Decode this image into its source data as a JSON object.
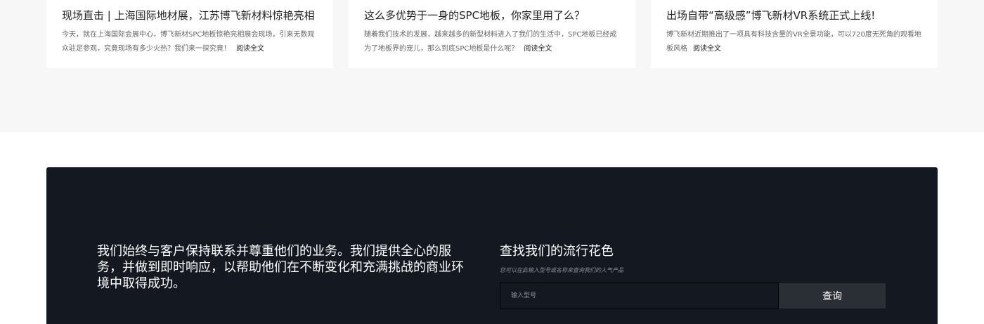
{
  "news": {
    "cards": [
      {
        "title": "现场直击 | 上海国际地材展，江苏博飞新材料惊艳亮相",
        "text": "今天，就在上海国际会展中心，博飞新材SPC地板惊艳亮相展会现场，引来无数观众驻足参观，究竟现场有多少火热？我们来一探究竟！",
        "read_more": "阅读全文"
      },
      {
        "title": "这么多优势于一身的SPC地板，你家里用了么？",
        "text": "随着我们技术的发展，越来越多的新型材料进入了我们的生活中，SPC地板已经成为了地板界的宠儿，那么到底SPC地板是什么呢？",
        "read_more": "阅读全文"
      },
      {
        "title": "出场自带“高级感”博飞新材VR系统正式上线!",
        "text": "博飞新材近期推出了一项具有科技含量的VR全景功能，可以720度无死角的观看地板风格",
        "read_more": "阅读全文"
      }
    ]
  },
  "cta": {
    "text": "我们始终与客户保持联系并尊重他们的业务。我们提供全心的服务，并做到即时响应，以帮助他们在不断变化和充满挑战的商业环境中取得成功。",
    "title": "查找我们的流行花色",
    "subtitle": "您可以在此输入型号或名称来查询我们的人气产品",
    "search_placeholder": "输入型号",
    "search_button": "查询"
  },
  "colors": {
    "band_bg": "#f7f7f7",
    "cta_bg": "#141820",
    "button_bg": "#2a2e35"
  }
}
